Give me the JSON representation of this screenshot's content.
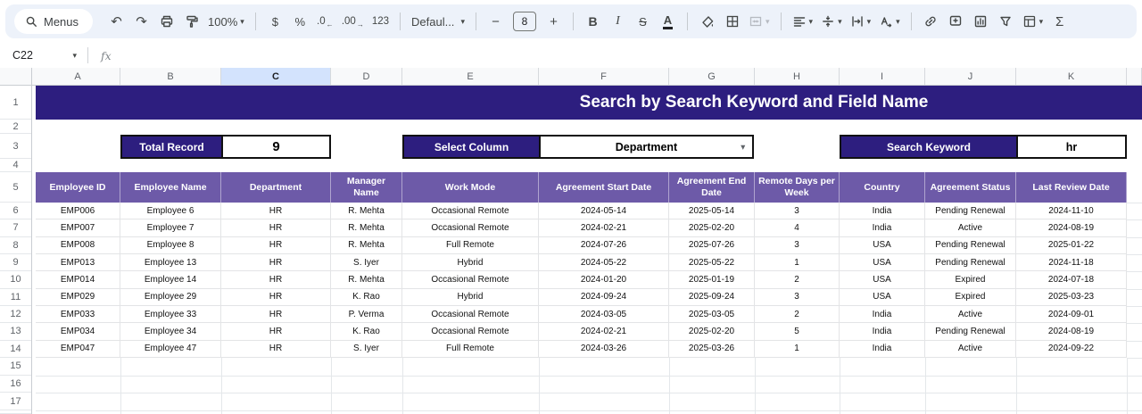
{
  "toolbar": {
    "menus_label": "Menus",
    "zoom_value": "100%",
    "currency": "$",
    "percent": "%",
    "decrease_decimal": ".0",
    "increase_decimal": ".00",
    "more_formats": "123",
    "font_name": "Defaul...",
    "font_size": "8",
    "bold": "B",
    "italic": "I",
    "strikethrough": "S",
    "text_color": "A",
    "functions": "Σ"
  },
  "icons": {
    "undo": "↶",
    "redo": "↷",
    "caret": "▾",
    "minus": "−",
    "plus": "+",
    "arrow_left": "←",
    "arrow_right": "→"
  },
  "formula_bar": {
    "cell_reference": "C22",
    "fx_label": "fx"
  },
  "grid": {
    "column_letters": [
      "A",
      "B",
      "C",
      "D",
      "E",
      "F",
      "G",
      "H",
      "I",
      "J",
      "K"
    ],
    "selected_column": "C",
    "row_numbers": [
      "1",
      "2",
      "3",
      "4",
      "5",
      "6",
      "7",
      "8",
      "9",
      "10",
      "11",
      "12",
      "13",
      "14",
      "15",
      "16",
      "17"
    ]
  },
  "sheet": {
    "title": "Search by Search Keyword and Field Name",
    "widgets": {
      "total_record_label": "Total Record",
      "total_record_value": "9",
      "select_column_label": "Select Column",
      "select_column_value": "Department",
      "search_keyword_label": "Search Keyword",
      "search_keyword_value": "hr"
    },
    "table": {
      "headers": [
        "Employee ID",
        "Employee Name",
        "Department",
        "Manager Name",
        "Work Mode",
        "Agreement Start Date",
        "Agreement End Date",
        "Remote Days per Week",
        "Country",
        "Agreement Status",
        "Last Review Date"
      ],
      "rows": [
        [
          "EMP006",
          "Employee 6",
          "HR",
          "R. Mehta",
          "Occasional Remote",
          "2024-05-14",
          "2025-05-14",
          "3",
          "India",
          "Pending Renewal",
          "2024-11-10"
        ],
        [
          "EMP007",
          "Employee 7",
          "HR",
          "R. Mehta",
          "Occasional Remote",
          "2024-02-21",
          "2025-02-20",
          "4",
          "India",
          "Active",
          "2024-08-19"
        ],
        [
          "EMP008",
          "Employee 8",
          "HR",
          "R. Mehta",
          "Full Remote",
          "2024-07-26",
          "2025-07-26",
          "3",
          "USA",
          "Pending Renewal",
          "2025-01-22"
        ],
        [
          "EMP013",
          "Employee 13",
          "HR",
          "S. Iyer",
          "Hybrid",
          "2024-05-22",
          "2025-05-22",
          "1",
          "USA",
          "Pending Renewal",
          "2024-11-18"
        ],
        [
          "EMP014",
          "Employee 14",
          "HR",
          "R. Mehta",
          "Occasional Remote",
          "2024-01-20",
          "2025-01-19",
          "2",
          "USA",
          "Expired",
          "2024-07-18"
        ],
        [
          "EMP029",
          "Employee 29",
          "HR",
          "K. Rao",
          "Hybrid",
          "2024-09-24",
          "2025-09-24",
          "3",
          "USA",
          "Expired",
          "2025-03-23"
        ],
        [
          "EMP033",
          "Employee 33",
          "HR",
          "P. Verma",
          "Occasional Remote",
          "2024-03-05",
          "2025-03-05",
          "2",
          "India",
          "Active",
          "2024-09-01"
        ],
        [
          "EMP034",
          "Employee 34",
          "HR",
          "K. Rao",
          "Occasional Remote",
          "2024-02-21",
          "2025-02-20",
          "5",
          "India",
          "Pending Renewal",
          "2024-08-19"
        ],
        [
          "EMP047",
          "Employee 47",
          "HR",
          "S. Iyer",
          "Full Remote",
          "2024-03-26",
          "2025-03-26",
          "1",
          "India",
          "Active",
          "2024-09-22"
        ]
      ]
    }
  },
  "colors": {
    "banner": "#2d1e7f",
    "table_header": "#6d5aa8",
    "selected_column_fill": "#d3e3fd",
    "toolbar_bg": "#edf2fa"
  }
}
